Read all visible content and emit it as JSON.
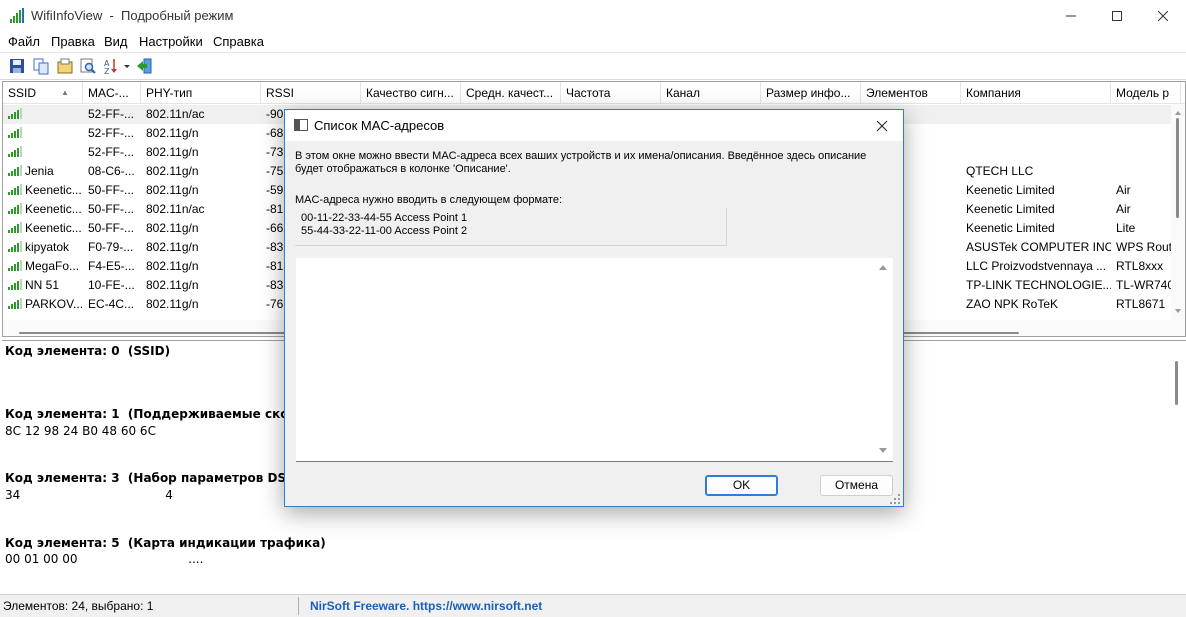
{
  "window": {
    "title": "WifiInfoView  -  Подробный режим",
    "colors": {
      "accent": "#2e7dd7",
      "link": "#1b5fb8",
      "selected_row": "#f0f0f0",
      "signal_green": "#2e9a2e"
    }
  },
  "menu": [
    "Файл",
    "Правка",
    "Вид",
    "Настройки",
    "Справка"
  ],
  "toolbar": {
    "icons": [
      "save-icon",
      "copy-icon",
      "properties-icon",
      "find-icon",
      "sort-icon",
      "exit-icon"
    ]
  },
  "list": {
    "columns": [
      "SSID",
      "MAC-...",
      "PHY-тип",
      "RSSI",
      "Качество сигн...",
      "Средн. качест...",
      "Частота",
      "Канал",
      "Размер инфо...",
      "Элементов",
      "Компания",
      "Модель р"
    ],
    "rows": [
      {
        "ssid": "",
        "mac": "52-FF-...",
        "phy": "802.11n/ac",
        "rssi": "-90",
        "company": "",
        "model": "",
        "selected": true
      },
      {
        "ssid": "",
        "mac": "52-FF-...",
        "phy": "802.11g/n",
        "rssi": "-68",
        "company": "",
        "model": ""
      },
      {
        "ssid": "",
        "mac": "52-FF-...",
        "phy": "802.11g/n",
        "rssi": "-73",
        "company": "",
        "model": ""
      },
      {
        "ssid": "Jenia",
        "mac": "08-C6-...",
        "phy": "802.11g/n",
        "rssi": "-75",
        "company": "QTECH LLC",
        "model": ""
      },
      {
        "ssid": "Keenetic...",
        "mac": "50-FF-...",
        "phy": "802.11g/n",
        "rssi": "-59",
        "company": "Keenetic Limited",
        "model": "Air"
      },
      {
        "ssid": "Keenetic...",
        "mac": "50-FF-...",
        "phy": "802.11n/ac",
        "rssi": "-81",
        "company": "Keenetic Limited",
        "model": "Air"
      },
      {
        "ssid": "Keenetic...",
        "mac": "50-FF-...",
        "phy": "802.11g/n",
        "rssi": "-66",
        "company": "Keenetic Limited",
        "model": "Lite"
      },
      {
        "ssid": "kipyatok",
        "mac": "F0-79-...",
        "phy": "802.11g/n",
        "rssi": "-83",
        "company": "ASUSTek COMPUTER INC.",
        "model": "WPS Rout"
      },
      {
        "ssid": "MegaFo...",
        "mac": "F4-E5-...",
        "phy": "802.11g/n",
        "rssi": "-81",
        "company": "LLC Proizvodstvennaya ...",
        "model": "RTL8xxx"
      },
      {
        "ssid": "NN 51",
        "mac": "10-FE-...",
        "phy": "802.11g/n",
        "rssi": "-83",
        "company": "TP-LINK TECHNOLOGIE...",
        "model": "TL-WR740"
      },
      {
        "ssid": "PARKOV...",
        "mac": "EC-4C...",
        "phy": "802.11g/n",
        "rssi": "-76",
        "company": "ZAO NPK RoTeK",
        "model": "RTL8671"
      }
    ]
  },
  "details": [
    {
      "text": "Код элемента: 0  (SSID)",
      "bold": true
    },
    {
      "text": "Код элемента: 1  (Поддерживаемые скор",
      "bold": true
    },
    {
      "text": "8C 12 98 24 B0 48 60 6C                                    .........",
      "bold": false
    },
    {
      "text": "Код элемента: 3  (Набор параметров DS)",
      "bold": true
    },
    {
      "text": "34                                      4",
      "bold": false
    },
    {
      "text": "Код элемента: 5  (Карта индикации трафика)",
      "bold": true
    },
    {
      "text": "00 01 00 00                             ....",
      "bold": false
    }
  ],
  "status": {
    "left": "Элементов: 24, выбрано: 1",
    "link": "NirSoft Freeware. https://www.nirsoft.net"
  },
  "dialog": {
    "title": "Список MAC-адресов",
    "description": "В этом окне можно ввести MAC-адреса всех ваших устройств и их имена/описания. Введённое здесь описание будет отображаться в колонке 'Описание'.",
    "format_label": "MAC-адреса нужно вводить в следующем формате:",
    "examples": [
      "00-11-22-33-44-55 Access Point 1",
      "55-44-33-22-11-00 Access Point 2"
    ],
    "textarea_value": "",
    "ok_label": "OK",
    "cancel_label": "Отмена"
  }
}
